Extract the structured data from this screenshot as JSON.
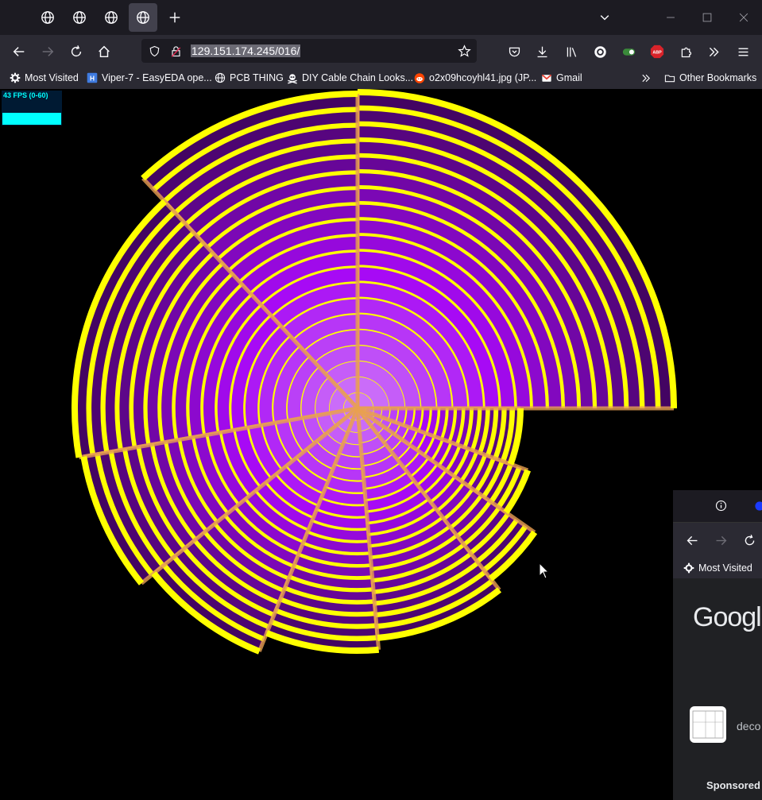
{
  "browser": {
    "url": "129.151.174.245/016/",
    "colors": {
      "tabbar": "#1c1b22",
      "toolbar": "#2b2a33",
      "urlbar": "#1c1b22"
    },
    "tabs": [
      {
        "icon": "globe-icon",
        "active": false
      },
      {
        "icon": "globe-icon",
        "active": false
      },
      {
        "icon": "globe-icon",
        "active": false
      },
      {
        "icon": "globe-icon",
        "active": true
      }
    ],
    "bookmarks": [
      {
        "label": "Most Visited",
        "icon": "gear-icon"
      },
      {
        "label": "Viper-7 - EasyEDA ope...",
        "icon": "easyeda-icon"
      },
      {
        "label": "PCB THING",
        "icon": "globe-icon"
      },
      {
        "label": "DIY Cable Chain Looks...",
        "icon": "skull-icon"
      },
      {
        "label": "o2x09hcoyhl41.jpg (JP...",
        "icon": "reddit-icon"
      },
      {
        "label": "Gmail",
        "icon": "gmail-icon"
      }
    ],
    "other_bookmarks": "Other Bookmarks"
  },
  "page": {
    "fps_label": "43 FPS (0-60)",
    "visual_colors": {
      "stroke": "#ffff00",
      "fill": "#8a0ad6",
      "spoke": "#e8a050",
      "background": "#000000"
    }
  },
  "popup_window": {
    "bookmark": "Most Visited",
    "logo_text": "Google",
    "result_snippet": "deco",
    "sponsored_label": "Sponsored"
  }
}
